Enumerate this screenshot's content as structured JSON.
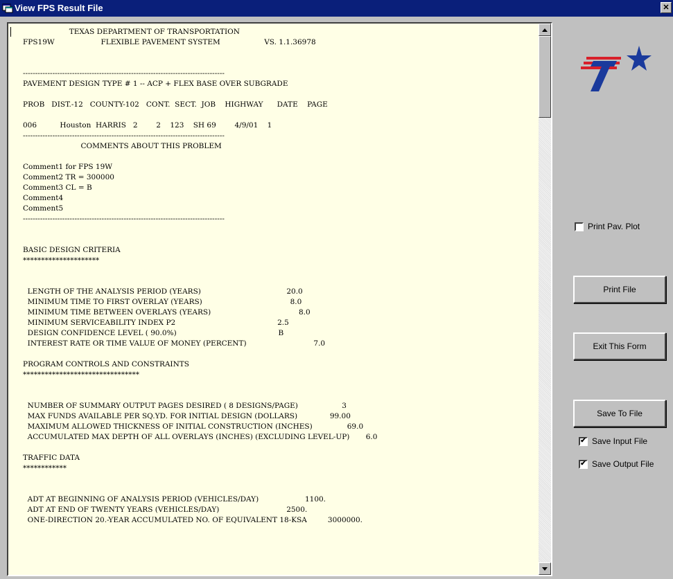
{
  "window": {
    "title": "View FPS Result File",
    "close_glyph": "✕"
  },
  "report": {
    "lines": [
      "                    TEXAS DEPARTMENT OF TRANSPORTATION",
      "FPS19W                    FLEXIBLE PAVEMENT SYSTEM                   VS. 1.1.36978",
      "",
      "",
      "----------------------------------------------------------------------------------",
      "PAVEMENT DESIGN TYPE # 1 -- ACP + FLEX BASE OVER SUBGRADE",
      "",
      "PROB   DIST.-12   COUNTY-102   CONT.  SECT.  JOB    HIGHWAY      DATE    PAGE",
      "",
      "006          Houston  HARRIS   2        2    123    SH 69        4/9/01    1",
      "----------------------------------------------------------------------------------",
      "                         COMMENTS ABOUT THIS PROBLEM",
      "",
      "Comment1 for FPS 19W",
      "Comment2 TR = 300000",
      "Comment3 CL = B",
      "Comment4",
      "Comment5",
      "----------------------------------------------------------------------------------",
      "",
      "",
      "BASIC DESIGN CRITERIA",
      "*********************",
      "",
      "",
      "  LENGTH OF THE ANALYSIS PERIOD (YEARS)                                     20.0",
      "  MINIMUM TIME TO FIRST OVERLAY (YEARS)                                      8.0",
      "  MINIMUM TIME BETWEEN OVERLAYS (YEARS)                                      8.0",
      "  MINIMUM SERVICEABILITY INDEX P2                                            2.5",
      "  DESIGN CONFIDENCE LEVEL ( 90.0%)                                            B",
      "  INTEREST RATE OR TIME VALUE OF MONEY (PERCENT)                             7.0",
      "",
      "PROGRAM CONTROLS AND CONSTRAINTS",
      "********************************",
      "",
      "",
      "  NUMBER OF SUMMARY OUTPUT PAGES DESIRED ( 8 DESIGNS/PAGE)                   3",
      "  MAX FUNDS AVAILABLE PER SQ.YD. FOR INITIAL DESIGN (DOLLARS)              99.00",
      "  MAXIMUM ALLOWED THICKNESS OF INITIAL CONSTRUCTION (INCHES)               69.0",
      "  ACCUMULATED MAX DEPTH OF ALL OVERLAYS (INCHES) (EXCLUDING LEVEL-UP)       6.0",
      "",
      "TRAFFIC DATA",
      "************",
      "",
      "",
      "  ADT AT BEGINNING OF ANALYSIS PERIOD (VEHICLES/DAY)                    1100.",
      "  ADT AT END OF TWENTY YEARS (VEHICLES/DAY)                             2500.",
      "  ONE-DIRECTION 20.-YEAR ACCUMULATED NO. OF EQUIVALENT 18-KSA         3000000."
    ]
  },
  "options": {
    "print_pav_plot": {
      "label": "Print Pav.  Plot",
      "checked": false
    },
    "save_input_file": {
      "label": "Save Input File",
      "checked": true
    },
    "save_output_file": {
      "label": "Save Output File",
      "checked": true
    }
  },
  "buttons": {
    "print_file": "Print File",
    "exit_form": "Exit This Form",
    "save_to_file": "Save To File"
  },
  "colors": {
    "titlebar": "#0a1f7a",
    "report_background": "#ffffe6",
    "logo_blue": "#1a3a9c",
    "logo_red": "#d8202a"
  }
}
